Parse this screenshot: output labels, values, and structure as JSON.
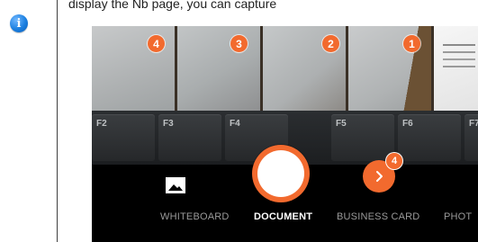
{
  "caption": {
    "text": "display the Nb page, you can capture"
  },
  "info": {
    "glyph": "i",
    "icon": "info-icon",
    "color": "#1b7fe0"
  },
  "camera": {
    "accent": "#f26a2e",
    "thumbnails": [
      {
        "badge": "4"
      },
      {
        "badge": "3"
      },
      {
        "badge": "2"
      },
      {
        "badge": "1"
      },
      {
        "badge": ""
      }
    ],
    "keys": [
      "F2",
      "F3",
      "F4",
      "F5",
      "F6",
      "F7"
    ],
    "gallery_icon": "image-icon",
    "next_icon": "chevron-right-icon",
    "next_badge": "4",
    "modes": [
      "WHITEBOARD",
      "DOCUMENT",
      "BUSINESS CARD",
      "PHOT"
    ],
    "active_mode": "DOCUMENT"
  }
}
